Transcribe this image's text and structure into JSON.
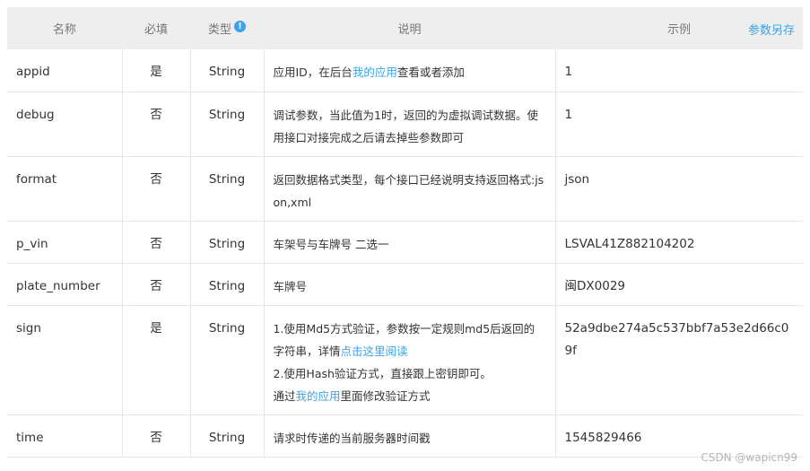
{
  "header": {
    "name": "名称",
    "required": "必填",
    "type": "类型",
    "info_icon": "info-circle-icon",
    "desc": "说明",
    "example": "示例",
    "save_link": "参数另存"
  },
  "rows": [
    {
      "name": "appid",
      "required": "是",
      "type": "String",
      "desc": [
        [
          "应用ID，在后台",
          ""
        ],
        [
          "我的应用",
          "link"
        ],
        [
          "查看或者添加",
          ""
        ]
      ],
      "example": "1"
    },
    {
      "name": "debug",
      "required": "否",
      "type": "String",
      "desc": [
        [
          "调试参数，当此值为1时，返回的为虚拟调试数据。使用接口对接完成之后请去掉些参数即可",
          ""
        ]
      ],
      "example": "1"
    },
    {
      "name": "format",
      "required": "否",
      "type": "String",
      "desc": [
        [
          "返回数据格式类型，每个接口已经说明支持返回格式:json,xml",
          ""
        ]
      ],
      "example": "json"
    },
    {
      "name": "p_vin",
      "required": "否",
      "type": "String",
      "desc": [
        [
          "车架号与车牌号 二选一",
          ""
        ]
      ],
      "example": "LSVAL41Z882104202"
    },
    {
      "name": "plate_number",
      "required": "否",
      "type": "String",
      "desc": [
        [
          "车牌号",
          ""
        ]
      ],
      "example": "闽DX0029"
    },
    {
      "name": "sign",
      "required": "是",
      "type": "String",
      "desc": [
        [
          "1.使用Md5方式验证，参数按一定规则md5后返回的字符串，详情",
          ""
        ],
        [
          "点击这里阅读",
          "link"
        ],
        [
          "",
          "br"
        ],
        [
          "2.使用Hash验证方式，直接跟上密钥即可。",
          ""
        ],
        [
          "",
          "br"
        ],
        [
          "通过",
          ""
        ],
        [
          "我的应用",
          "link"
        ],
        [
          "里面修改验证方式",
          ""
        ]
      ],
      "example": "52a9dbe274a5c537bbf7a53e2d66c09f"
    },
    {
      "name": "time",
      "required": "否",
      "type": "String",
      "desc": [
        [
          "请求时传递的当前服务器时间戳",
          ""
        ]
      ],
      "example": "1545829466"
    }
  ],
  "watermark": "CSDN @wapicn99"
}
